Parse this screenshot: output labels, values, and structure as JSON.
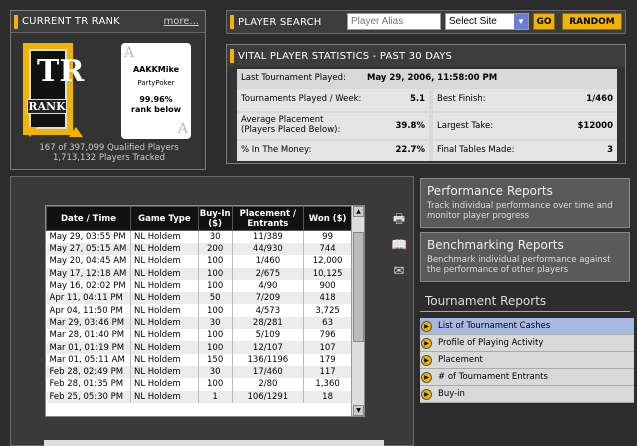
{
  "rank": {
    "title": "CURRENT TR RANK",
    "more": "more...",
    "logo_letters": "TR",
    "logo_word": "RANK",
    "card": {
      "name": "AAKKMike",
      "site": "PartyPoker",
      "pct": "99.96%",
      "below": "rank below",
      "corner": "A"
    },
    "qualified": "167 of 397,099 Qualified Players",
    "tracked": "1,713,132 Players Tracked"
  },
  "search": {
    "title": "PLAYER SEARCH",
    "alias_placeholder": "Player Alias",
    "site_selected": "Select Site",
    "go": "GO",
    "random": "RANDOM"
  },
  "stats": {
    "title": "VITAL PLAYER STATISTICS - PAST 30 DAYS",
    "last_label": "Last Tournament Played:",
    "last_value": "May 29, 2006, 11:58:00 PM",
    "tpw_label": "Tournaments Played / Week:",
    "tpw_value": "5.1",
    "best_label": "Best Finish:",
    "best_value": "1/460",
    "avg_label1": "Average Placement",
    "avg_label2": "(Players Placed Below):",
    "avg_value": "39.8%",
    "take_label": "Largest Take:",
    "take_value": "$12000",
    "itm_label": "% In The Money:",
    "itm_value": "22.7%",
    "ft_label": "Final Tables Made:",
    "ft_value": "3"
  },
  "table": {
    "headers": [
      "Date / Time",
      "Game Type",
      "Buy-In ($)",
      "Placement / Entrants",
      "Won ($)"
    ],
    "rows": [
      [
        "May 29, 03:55 PM",
        "NL Holdem",
        "30",
        "11/389",
        "99"
      ],
      [
        "May 27, 05:15 AM",
        "NL Holdem",
        "200",
        "44/930",
        "744"
      ],
      [
        "May 20, 04:45 AM",
        "NL Holdem",
        "100",
        "1/460",
        "12,000"
      ],
      [
        "May 17, 12:18 AM",
        "NL Holdem",
        "100",
        "2/675",
        "10,125"
      ],
      [
        "May 16, 02:02 PM",
        "NL Holdem",
        "100",
        "4/90",
        "900"
      ],
      [
        "Apr 11, 04:11 PM",
        "NL Holdem",
        "50",
        "7/209",
        "418"
      ],
      [
        "Apr 04, 11:50 PM",
        "NL Holdem",
        "100",
        "4/573",
        "3,725"
      ],
      [
        "Mar 29, 03:46 PM",
        "NL Holdem",
        "30",
        "28/281",
        "63"
      ],
      [
        "Mar 28, 01:40 PM",
        "NL Holdem",
        "100",
        "5/109",
        "796"
      ],
      [
        "Mar 01, 01:19 PM",
        "NL Holdem",
        "100",
        "12/107",
        "107"
      ],
      [
        "Mar 01, 05:11 AM",
        "NL Holdem",
        "150",
        "136/1196",
        "179"
      ],
      [
        "Feb 28, 02:49 PM",
        "NL Holdem",
        "30",
        "17/460",
        "117"
      ],
      [
        "Feb 28, 01:35 PM",
        "NL Holdem",
        "100",
        "2/80",
        "1,360"
      ],
      [
        "Feb 25, 05:30 PM",
        "NL Holdem",
        "1",
        "106/1291",
        "18"
      ]
    ]
  },
  "reports": {
    "perf_title": "Performance Reports",
    "perf_desc": "Track individual performance over time and monitor player progress",
    "bench_title": "Benchmarking Reports",
    "bench_desc": "Benchmark individual performance against the performance of other players",
    "tour_title": "Tournament Reports",
    "items": [
      "List of Tournament Cashes",
      "Profile of Playing Activity",
      "Placement",
      "# of Tournament Entrants",
      "Buy-in"
    ]
  },
  "colors": {
    "accent": "#f0b400",
    "panel": "#333333",
    "selected": "#a8b8e0"
  }
}
